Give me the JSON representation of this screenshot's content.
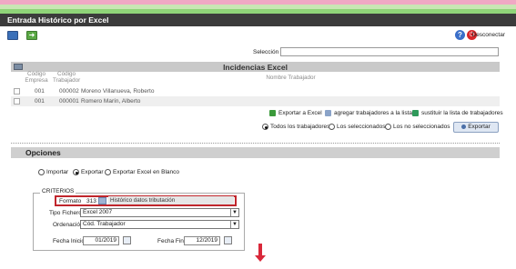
{
  "colors": {
    "stripe_pink": "#f0a8c4",
    "stripe_green": "#8fd478",
    "title_bg": "#3b3b3b",
    "highlight_border": "#c0262c",
    "arrow": "#d9283a"
  },
  "window": {
    "title": "Entrada Histórico por Excel"
  },
  "toolbar": {
    "disconnect_label": "Desconectar",
    "icons": [
      "mail-icon",
      "back-arrow-icon",
      "help-icon",
      "power-icon"
    ]
  },
  "seleccion": {
    "label": "Selección",
    "value": ""
  },
  "incidencias": {
    "title": "Incidencias Excel",
    "columns": {
      "empresa": "Código Empresa",
      "trabajador": "Código Trabajador",
      "nombre": "Nombre Trabajador"
    },
    "rows": [
      {
        "empresa": "001",
        "codigo": "000002",
        "nombre": "Moreno Villanueva, Roberto"
      },
      {
        "empresa": "001",
        "codigo": "000001",
        "nombre": "Romero Marín, Alberto"
      }
    ],
    "actions": {
      "export": "Exportar a Excel",
      "add": "agregar trabajadores a la lista",
      "replace": "sustituir la lista de trabajadores"
    },
    "filter": {
      "all": "Todos los trabajadores",
      "selected": "Los seleccionados",
      "not_selected": "Los no seleccionados",
      "current": "all"
    },
    "export_button": "Exportar"
  },
  "opciones": {
    "title": "Opciones",
    "modes": {
      "import": "Importar",
      "export": "Exportar",
      "blank": "Exportar Excel en Blanco",
      "current": "export"
    },
    "criterios": {
      "title": "CRITERIOS",
      "formato_label": "Formato",
      "formato_code": "313",
      "formato_desc": "Histórico datos tributación",
      "tipo_label": "Tipo Fichero",
      "tipo_value": "Excel 2007",
      "orden_label": "Ordenación",
      "orden_value": "Cód. Trabajador",
      "fecha_inicio_label": "Fecha Inicio",
      "fecha_inicio": "01/2019",
      "fecha_fin_label": "Fecha Fin",
      "fecha_fin": "12/2019"
    }
  }
}
